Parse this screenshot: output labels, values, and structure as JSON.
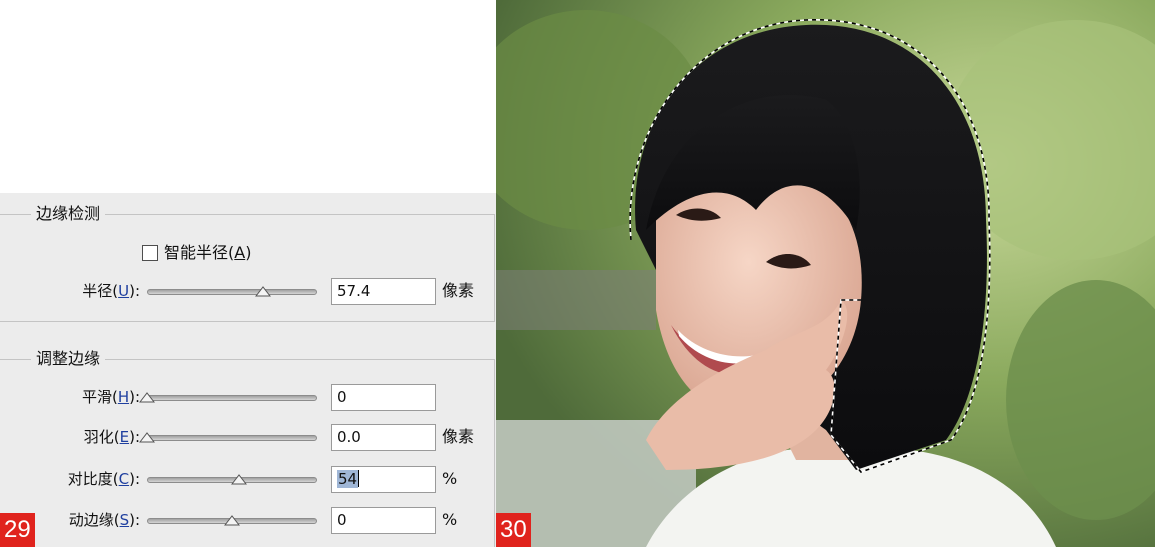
{
  "left_panel": {
    "edge_detection": {
      "title": "边缘检测",
      "smart_radius": {
        "label": "智能半径",
        "hotkey": "A",
        "checked": false
      },
      "radius": {
        "label": "半径",
        "hotkey": "U",
        "value": "57.4",
        "unit": "像素",
        "slider_fraction": 0.68
      }
    },
    "adjust_edge": {
      "title": "调整边缘",
      "smooth": {
        "label": "平滑",
        "hotkey": "H",
        "value": "0",
        "slider_fraction": 0.0
      },
      "feather": {
        "label": "羽化",
        "hotkey": "E",
        "value": "0.0",
        "unit": "像素",
        "slider_fraction": 0.0
      },
      "contrast": {
        "label": "对比度",
        "hotkey": "C",
        "value": "54",
        "unit": "%",
        "slider_fraction": 0.54
      },
      "shift_edge": {
        "label": "移动边缘",
        "label_visible": "动边缘",
        "hotkey": "S",
        "value": "0",
        "unit": "%",
        "slider_fraction": 0.5
      }
    },
    "figure_number": "29"
  },
  "right_panel": {
    "figure_number": "30",
    "subject": "portrait of smiling woman with short black hair, marching-ants selection around hair"
  },
  "colors": {
    "dialog_bg": "#ececec",
    "figure_badge": "#e0231d",
    "hotkey": "#1f3f9f"
  },
  "icons": [
    "slider-thumb-icon",
    "checkbox-icon"
  ]
}
